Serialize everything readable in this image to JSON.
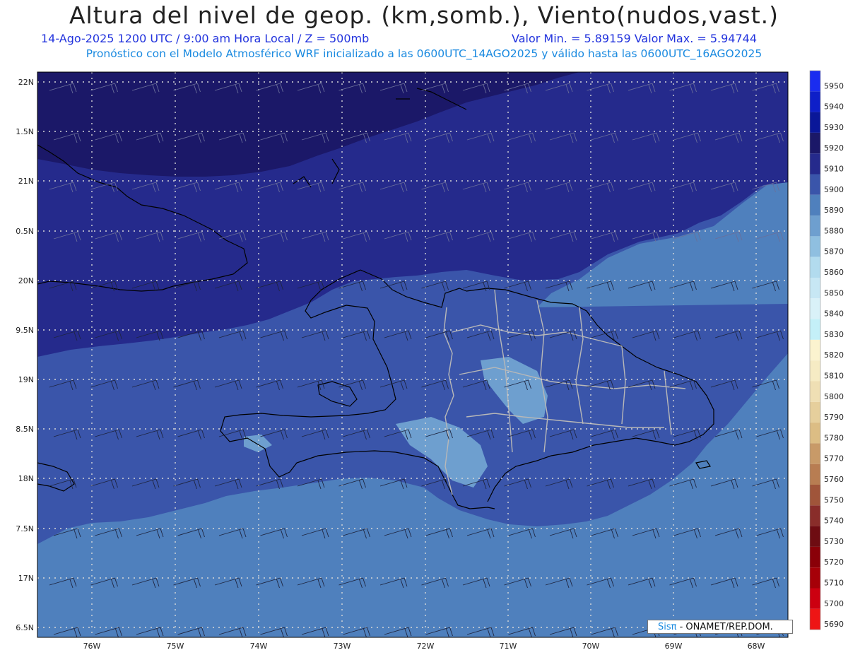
{
  "title": "Altura del nivel de geop. (km,somb.), Viento(nudos,vast.)",
  "subtitle_left": "14-Ago-2025  1200 UTC / 9:00 am Hora Local / Z = 500mb",
  "subtitle_right": "Valor Min. = 5.89159  Valor Max. = 5.94744",
  "subtitle2": "Pronóstico con el Modelo Atmosférico WRF inicializado a las 0600UTC_14AGO2025 y válido hasta las  0600UTC_16AGO2025",
  "credit_logo": "Sisπ",
  "credit_text": "- ONAMET/REP.DOM.",
  "lat_labels": [
    "22N",
    "1.5N",
    "21N",
    "0.5N",
    "20N",
    "9.5N",
    "19N",
    "8.5N",
    "18N",
    "7.5N",
    "17N",
    "6.5N"
  ],
  "lon_labels": [
    "76W",
    "75W",
    "74W",
    "73W",
    "72W",
    "71W",
    "70W",
    "69W",
    "68W"
  ],
  "colorbar": {
    "levels": [
      "5950",
      "5940",
      "5930",
      "5920",
      "5910",
      "5900",
      "5890",
      "5880",
      "5870",
      "5860",
      "5850",
      "5840",
      "5830",
      "5820",
      "5810",
      "5800",
      "5790",
      "5780",
      "5770",
      "5760",
      "5750",
      "5740",
      "5730",
      "5720",
      "5710",
      "5700",
      "5690"
    ],
    "colors": [
      "#1a2cf0",
      "#0e1fc8",
      "#0a1799",
      "#1b1868",
      "#252a8c",
      "#3a55aa",
      "#4f80bd",
      "#6e9fcf",
      "#8fbfe0",
      "#b2dbee",
      "#c7e7f4",
      "#d9f1f8",
      "#c4f0f8",
      "#fbf3cf",
      "#f6ebc4",
      "#efdfb4",
      "#e6cf9c",
      "#dcbd84",
      "#c89a68",
      "#b87d52",
      "#a0553a",
      "#892d2a",
      "#6e0c12",
      "#8a0008",
      "#a60008",
      "#cc0010",
      "#ee1515"
    ]
  },
  "legend_colors": {
    "5920": "#1b1868",
    "5910": "#252a8c",
    "5900": "#3a55aa",
    "5890": "#4f80bd",
    "5880": "#6e9fcf"
  }
}
